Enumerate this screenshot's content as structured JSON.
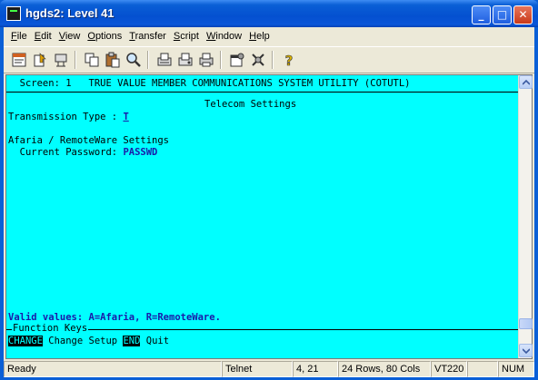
{
  "window": {
    "title": "hgds2: Level 41",
    "minimize": "_",
    "maximize": "□",
    "close": "✕"
  },
  "menu": [
    {
      "accel": "F",
      "rest": "ile"
    },
    {
      "accel": "E",
      "rest": "dit"
    },
    {
      "accel": "V",
      "rest": "iew"
    },
    {
      "accel": "O",
      "rest": "ptions"
    },
    {
      "accel": "T",
      "rest": "ransfer"
    },
    {
      "accel": "S",
      "rest": "cript"
    },
    {
      "accel": "W",
      "rest": "indow"
    },
    {
      "accel": "H",
      "rest": "elp"
    }
  ],
  "toolbar": {
    "icons": [
      "new-session-icon",
      "connect-icon",
      "disconnect-icon",
      "copy-icon",
      "paste-icon",
      "find-icon",
      "send-file-icon",
      "receive-file-icon",
      "print-icon",
      "settings-icon",
      "tools-icon",
      "help-icon"
    ],
    "help_glyph": "?"
  },
  "terminal": {
    "header": "  Screen: 1   TRUE VALUE MEMBER COMMUNICATIONS SYSTEM UTILITY (COTUTL)",
    "section_title": "Telecom Settings",
    "transmission_label": "Transmission Type : ",
    "transmission_value": "T",
    "afaria_heading": "Afaria / RemoteWare Settings",
    "password_label": "  Current Password: ",
    "password_value": "PASSWD",
    "valid_values": "Valid values: A=Afaria, R=RemoteWare.",
    "function_keys_label": "Function Keys",
    "key1": "CHANGE",
    "key1_desc": " Change Setup ",
    "key2": "END",
    "key2_desc": " Quit"
  },
  "colors": {
    "terminal_bg": "#00ffff",
    "field_text": "#1a1aa8"
  },
  "status": {
    "ready": "Ready",
    "protocol": "Telnet",
    "cursor": "4, 21",
    "size": "24 Rows, 80 Cols",
    "emulation": "VT220",
    "empty": "",
    "num": "NUM"
  }
}
